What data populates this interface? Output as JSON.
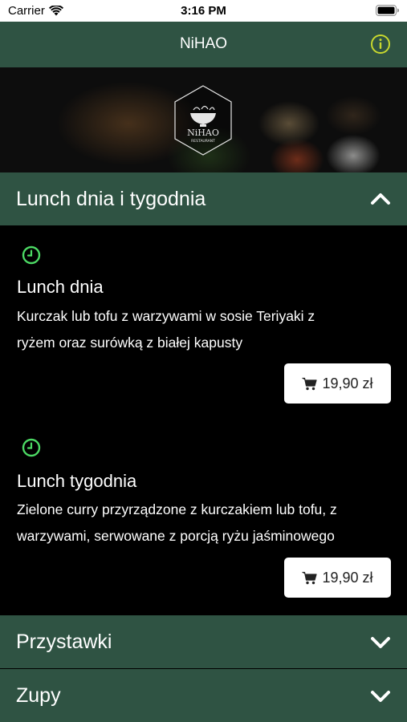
{
  "status_bar": {
    "carrier": "Carrier",
    "time": "3:16 PM"
  },
  "nav": {
    "title": "NiHAO"
  },
  "hero": {
    "logo_text": "NiHAO",
    "logo_subtext": "RESTAURANT"
  },
  "sections": [
    {
      "label": "Lunch dnia i tygodnia",
      "expanded": true
    },
    {
      "label": "Przystawki",
      "expanded": false
    },
    {
      "label": "Zupy",
      "expanded": false
    }
  ],
  "items": [
    {
      "name": "Lunch dnia",
      "description_line1": "Kurczak lub tofu z warzywami w sosie Teriyaki z",
      "description_line2": "ryżem oraz surówką z białej kapusty",
      "price": "19,90 zł"
    },
    {
      "name": "Lunch tygodnia",
      "description_line1": "Zielone curry przyrządzone z kurczakiem lub tofu, z",
      "description_line2": "warzywami, serwowane z porcją ryżu jaśminowego",
      "price": "19,90 zł"
    }
  ],
  "colors": {
    "header_green": "#2f5343",
    "accent_clock": "#4cd964",
    "info_icon": "#c8d82e"
  }
}
